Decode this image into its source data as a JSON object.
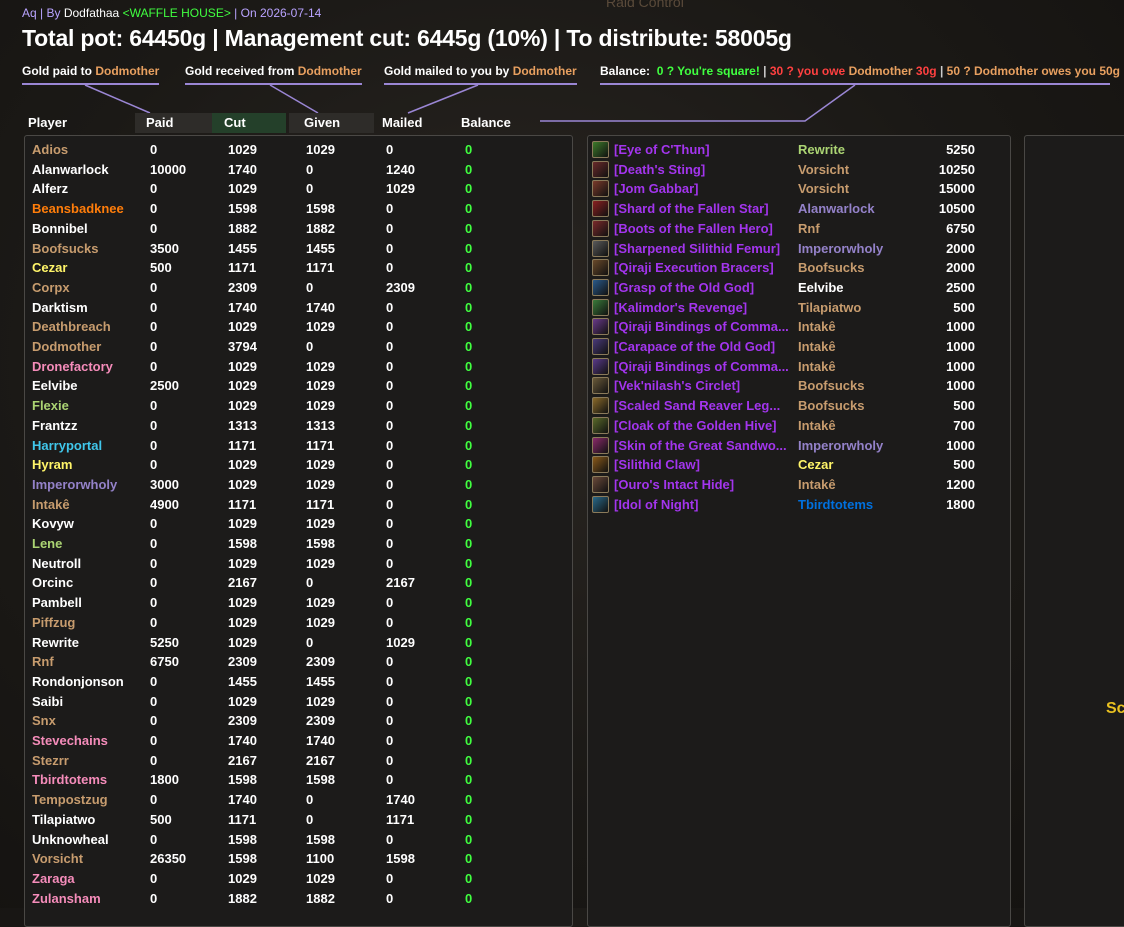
{
  "header": {
    "raid": "Aq",
    "by_label": "By",
    "author": "Dodfathaa",
    "guild": "<WAFFLE HOUSE>",
    "date_label": "On 2026-07-14",
    "title": "Total pot: 64450g | Management cut: 6445g (10%) | To distribute: 58005g",
    "background_title": "Raid Control"
  },
  "legend": {
    "paid_prefix": "Gold paid to",
    "paid_name": "Dodmother",
    "received_prefix": "Gold received from",
    "received_name": "Dodmother",
    "mailed_prefix": "Gold mailed to you by",
    "mailed_name": "Dodmother",
    "balance_label": "Balance:",
    "balance_zero": "0 ? You're square!",
    "balance_sep1": "|",
    "balance_owe_prefix": "30 ? you owe",
    "balance_owe_name": "Dodmother",
    "balance_owe_amount": "30g",
    "balance_sep2": "|",
    "balance_owed_text": "50 ? Dodmother owes you 50g"
  },
  "columns": {
    "player": "Player",
    "paid": "Paid",
    "cut": "Cut",
    "given": "Given",
    "mailed": "Mailed",
    "balance": "Balance"
  },
  "colors": {
    "rogue": "#fff569",
    "druid": "#ff7d0a",
    "hunter": "#abd473",
    "warlock": "#9482c9",
    "mage": "#40c7eb",
    "paladin": "#f58cba",
    "priest": "#ffffff",
    "warrior": "#c79c6e",
    "shaman": "#0070de",
    "epic": "#a335ee",
    "balance_zero": "#40ff40"
  },
  "players": [
    {
      "name": "Adios",
      "cls": "warrior",
      "paid": "0",
      "cut": "1029",
      "given": "1029",
      "mailed": "0",
      "balance": "0"
    },
    {
      "name": "Alanwarlock",
      "cls": "priest",
      "paid": "10000",
      "cut": "1740",
      "given": "0",
      "mailed": "1240",
      "balance": "0"
    },
    {
      "name": "Alferz",
      "cls": "priest",
      "paid": "0",
      "cut": "1029",
      "given": "0",
      "mailed": "1029",
      "balance": "0"
    },
    {
      "name": "Beansbadknee",
      "cls": "druid",
      "paid": "0",
      "cut": "1598",
      "given": "1598",
      "mailed": "0",
      "balance": "0"
    },
    {
      "name": "Bonnibel",
      "cls": "priest",
      "paid": "0",
      "cut": "1882",
      "given": "1882",
      "mailed": "0",
      "balance": "0"
    },
    {
      "name": "Boofsucks",
      "cls": "warrior",
      "paid": "3500",
      "cut": "1455",
      "given": "1455",
      "mailed": "0",
      "balance": "0"
    },
    {
      "name": "Cezar",
      "cls": "rogue",
      "paid": "500",
      "cut": "1171",
      "given": "1171",
      "mailed": "0",
      "balance": "0"
    },
    {
      "name": "Corpx",
      "cls": "warrior",
      "paid": "0",
      "cut": "2309",
      "given": "0",
      "mailed": "2309",
      "balance": "0"
    },
    {
      "name": "Darktism",
      "cls": "priest",
      "paid": "0",
      "cut": "1740",
      "given": "1740",
      "mailed": "0",
      "balance": "0"
    },
    {
      "name": "Deathbreach",
      "cls": "warrior",
      "paid": "0",
      "cut": "1029",
      "given": "1029",
      "mailed": "0",
      "balance": "0"
    },
    {
      "name": "Dodmother",
      "cls": "warrior",
      "paid": "0",
      "cut": "3794",
      "given": "0",
      "mailed": "0",
      "balance": "0"
    },
    {
      "name": "Dronefactory",
      "cls": "paladin",
      "paid": "0",
      "cut": "1029",
      "given": "1029",
      "mailed": "0",
      "balance": "0"
    },
    {
      "name": "Eelvibe",
      "cls": "priest",
      "paid": "2500",
      "cut": "1029",
      "given": "1029",
      "mailed": "0",
      "balance": "0"
    },
    {
      "name": "Flexie",
      "cls": "hunter",
      "paid": "0",
      "cut": "1029",
      "given": "1029",
      "mailed": "0",
      "balance": "0"
    },
    {
      "name": "Frantzz",
      "cls": "priest",
      "paid": "0",
      "cut": "1313",
      "given": "1313",
      "mailed": "0",
      "balance": "0"
    },
    {
      "name": "Harryportal",
      "cls": "mage",
      "paid": "0",
      "cut": "1171",
      "given": "1171",
      "mailed": "0",
      "balance": "0"
    },
    {
      "name": "Hyram",
      "cls": "rogue",
      "paid": "0",
      "cut": "1029",
      "given": "1029",
      "mailed": "0",
      "balance": "0"
    },
    {
      "name": "Imperorwholy",
      "cls": "warlock",
      "paid": "3000",
      "cut": "1029",
      "given": "1029",
      "mailed": "0",
      "balance": "0"
    },
    {
      "name": "Intakê",
      "cls": "warrior",
      "paid": "4900",
      "cut": "1171",
      "given": "1171",
      "mailed": "0",
      "balance": "0"
    },
    {
      "name": "Kovyw",
      "cls": "priest",
      "paid": "0",
      "cut": "1029",
      "given": "1029",
      "mailed": "0",
      "balance": "0"
    },
    {
      "name": "Lene",
      "cls": "hunter",
      "paid": "0",
      "cut": "1598",
      "given": "1598",
      "mailed": "0",
      "balance": "0"
    },
    {
      "name": "Neutroll",
      "cls": "priest",
      "paid": "0",
      "cut": "1029",
      "given": "1029",
      "mailed": "0",
      "balance": "0"
    },
    {
      "name": "Orcinc",
      "cls": "priest",
      "paid": "0",
      "cut": "2167",
      "given": "0",
      "mailed": "2167",
      "balance": "0"
    },
    {
      "name": "Pambell",
      "cls": "priest",
      "paid": "0",
      "cut": "1029",
      "given": "1029",
      "mailed": "0",
      "balance": "0"
    },
    {
      "name": "Piffzug",
      "cls": "warrior",
      "paid": "0",
      "cut": "1029",
      "given": "1029",
      "mailed": "0",
      "balance": "0"
    },
    {
      "name": "Rewrite",
      "cls": "priest",
      "paid": "5250",
      "cut": "1029",
      "given": "0",
      "mailed": "1029",
      "balance": "0"
    },
    {
      "name": "Rnf",
      "cls": "warrior",
      "paid": "6750",
      "cut": "2309",
      "given": "2309",
      "mailed": "0",
      "balance": "0"
    },
    {
      "name": "Rondonjonson",
      "cls": "priest",
      "paid": "0",
      "cut": "1455",
      "given": "1455",
      "mailed": "0",
      "balance": "0"
    },
    {
      "name": "Saibi",
      "cls": "priest",
      "paid": "0",
      "cut": "1029",
      "given": "1029",
      "mailed": "0",
      "balance": "0"
    },
    {
      "name": "Snx",
      "cls": "warrior",
      "paid": "0",
      "cut": "2309",
      "given": "2309",
      "mailed": "0",
      "balance": "0"
    },
    {
      "name": "Stevechains",
      "cls": "paladin",
      "paid": "0",
      "cut": "1740",
      "given": "1740",
      "mailed": "0",
      "balance": "0"
    },
    {
      "name": "Stezrr",
      "cls": "warrior",
      "paid": "0",
      "cut": "2167",
      "given": "2167",
      "mailed": "0",
      "balance": "0"
    },
    {
      "name": "Tbirdtotems",
      "cls": "paladin",
      "paid": "1800",
      "cut": "1598",
      "given": "1598",
      "mailed": "0",
      "balance": "0"
    },
    {
      "name": "Tempostzug",
      "cls": "warrior",
      "paid": "0",
      "cut": "1740",
      "given": "0",
      "mailed": "1740",
      "balance": "0"
    },
    {
      "name": "Tilapiatwo",
      "cls": "priest",
      "paid": "500",
      "cut": "1171",
      "given": "0",
      "mailed": "1171",
      "balance": "0"
    },
    {
      "name": "Unknowheal",
      "cls": "priest",
      "paid": "0",
      "cut": "1598",
      "given": "1598",
      "mailed": "0",
      "balance": "0"
    },
    {
      "name": "Vorsicht",
      "cls": "warrior",
      "paid": "26350",
      "cut": "1598",
      "given": "1100",
      "mailed": "1598",
      "balance": "0"
    },
    {
      "name": "Zaraga",
      "cls": "paladin",
      "paid": "0",
      "cut": "1029",
      "given": "1029",
      "mailed": "0",
      "balance": "0"
    },
    {
      "name": "Zulansham",
      "cls": "paladin",
      "paid": "0",
      "cut": "1882",
      "given": "1882",
      "mailed": "0",
      "balance": "0"
    }
  ],
  "loot": [
    {
      "item": "[Eye of C'Thun]",
      "icon": "eye-icon",
      "icon_color": "#3d7a2a",
      "winner": "Rewrite",
      "wcls": "hunter",
      "price": "5250"
    },
    {
      "item": "[Death's Sting]",
      "icon": "dagger-icon",
      "icon_color": "#6a2a2a",
      "winner": "Vorsicht",
      "wcls": "warrior",
      "price": "10250"
    },
    {
      "item": "[Jom Gabbar]",
      "icon": "trinket-icon",
      "icon_color": "#7a3a2a",
      "winner": "Vorsicht",
      "wcls": "warrior",
      "price": "15000"
    },
    {
      "item": "[Shard of the Fallen Star]",
      "icon": "shard-icon",
      "icon_color": "#8a2020",
      "winner": "Alanwarlock",
      "wcls": "warlock",
      "price": "10500"
    },
    {
      "item": "[Boots of the Fallen Hero]",
      "icon": "boots-icon",
      "icon_color": "#7a2a2a",
      "winner": "Rnf",
      "wcls": "warrior",
      "price": "6750"
    },
    {
      "item": "[Sharpened Silithid Femur]",
      "icon": "sword-icon",
      "icon_color": "#5a5a5a",
      "winner": "Imperorwholy",
      "wcls": "warlock",
      "price": "2000"
    },
    {
      "item": "[Qiraji Execution Bracers]",
      "icon": "bracers-icon",
      "icon_color": "#6a4a2a",
      "winner": "Boofsucks",
      "wcls": "warrior",
      "price": "2000"
    },
    {
      "item": "[Grasp of the Old God]",
      "icon": "staff-icon",
      "icon_color": "#2a5a8a",
      "winner": "Eelvibe",
      "wcls": "priest",
      "price": "2500"
    },
    {
      "item": "[Kalimdor's Revenge]",
      "icon": "sword-icon",
      "icon_color": "#3a7a3a",
      "winner": "Tilapiatwo",
      "wcls": "warrior",
      "price": "500"
    },
    {
      "item": "[Qiraji Bindings of Comma...",
      "icon": "bindings-icon",
      "icon_color": "#6a3a8a",
      "winner": "Intakê",
      "wcls": "warrior",
      "price": "1000"
    },
    {
      "item": "[Carapace of the Old God]",
      "icon": "carapace-icon",
      "icon_color": "#4a3a7a",
      "winner": "Intakê",
      "wcls": "warrior",
      "price": "1000"
    },
    {
      "item": "[Qiraji Bindings of Comma...",
      "icon": "bindings-icon",
      "icon_color": "#5a3a8a",
      "winner": "Intakê",
      "wcls": "warrior",
      "price": "1000"
    },
    {
      "item": "[Vek'nilash's Circlet]",
      "icon": "circlet-icon",
      "icon_color": "#6a5a3a",
      "winner": "Boofsucks",
      "wcls": "warrior",
      "price": "1000"
    },
    {
      "item": "[Scaled Sand Reaver Leg...",
      "icon": "legs-icon",
      "icon_color": "#8a6a2a",
      "winner": "Boofsucks",
      "wcls": "warrior",
      "price": "500"
    },
    {
      "item": "[Cloak of the Golden Hive]",
      "icon": "cloak-icon",
      "icon_color": "#5a6a2a",
      "winner": "Intakê",
      "wcls": "warrior",
      "price": "700"
    },
    {
      "item": "[Skin of the Great Sandwo...",
      "icon": "skin-icon",
      "icon_color": "#8a2a6a",
      "winner": "Imperorwholy",
      "wcls": "warlock",
      "price": "1000"
    },
    {
      "item": "[Silithid Claw]",
      "icon": "claw-icon",
      "icon_color": "#8a5a1a",
      "winner": "Cezar",
      "wcls": "rogue",
      "price": "500"
    },
    {
      "item": "[Ouro's Intact Hide]",
      "icon": "hide-icon",
      "icon_color": "#6a4a3a",
      "winner": "Intakê",
      "wcls": "warrior",
      "price": "1200"
    },
    {
      "item": "[Idol of Night]",
      "icon": "idol-icon",
      "icon_color": "#2a6a8a",
      "winner": "Tbirdtotems",
      "wcls": "shaman",
      "price": "1800"
    }
  ],
  "side_text": "Sc"
}
